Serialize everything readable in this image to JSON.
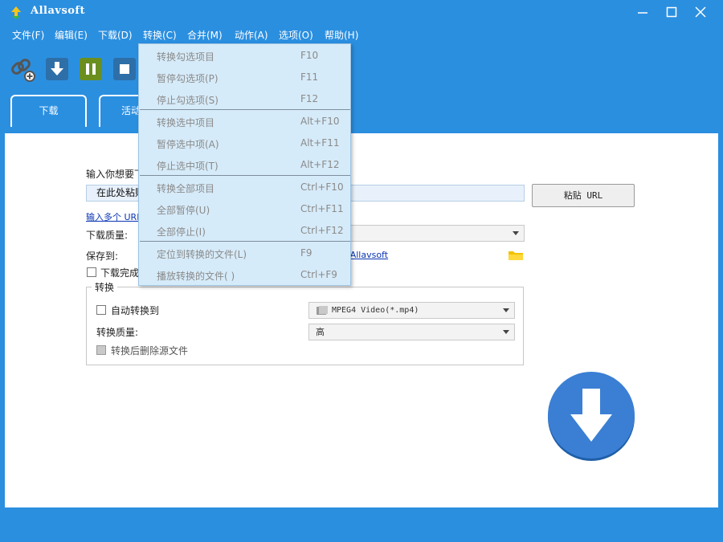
{
  "app": {
    "title": "Allavsoft"
  },
  "menubar": {
    "items": [
      {
        "label": "文件(F)"
      },
      {
        "label": "编辑(E)"
      },
      {
        "label": "下载(D)"
      },
      {
        "label": "转换(C)"
      },
      {
        "label": "合并(M)"
      },
      {
        "label": "动作(A)"
      },
      {
        "label": "选项(O)"
      },
      {
        "label": "帮助(H)"
      }
    ]
  },
  "tabs": {
    "download": "下载",
    "active": "活动"
  },
  "form": {
    "url_prompt": "输入你想要下",
    "url_input_value": "在此处粘贴",
    "paste_button": "粘贴 URL",
    "multi_url_link": "输入多个 URL",
    "quality_label": "下载质量:",
    "save_to_label": "保存到:",
    "save_path": "\\Allavsoft",
    "after_download_label": "下载完成"
  },
  "convert": {
    "group_label": "转换",
    "auto_convert_label": "自动转换到",
    "format_value": "MPEG4 Video(*.mp4)",
    "quality_label": "转换质量:",
    "quality_value": "高",
    "delete_source_label": "转换后删除源文件"
  },
  "convert_menu": {
    "groups": [
      [
        {
          "label": "转换勾选项目",
          "shortcut": "F10"
        },
        {
          "label": "暂停勾选项(P)",
          "shortcut": "F11"
        },
        {
          "label": "停止勾选项(S)",
          "shortcut": "F12"
        }
      ],
      [
        {
          "label": "转换选中项目",
          "shortcut": "Alt+F10"
        },
        {
          "label": "暂停选中项(A)",
          "shortcut": "Alt+F11"
        },
        {
          "label": "停止选中项(T)",
          "shortcut": "Alt+F12"
        }
      ],
      [
        {
          "label": "转换全部项目",
          "shortcut": "Ctrl+F10"
        },
        {
          "label": "全部暂停(U)",
          "shortcut": "Ctrl+F11"
        },
        {
          "label": "全部停止(I)",
          "shortcut": "Ctrl+F12"
        }
      ],
      [
        {
          "label": "定位到转换的文件(L)",
          "shortcut": "F9"
        },
        {
          "label": "播放转换的文件( )",
          "shortcut": "Ctrl+F9"
        }
      ]
    ]
  },
  "colors": {
    "accent": "#2b8fe0",
    "menu_bg": "#d6ebf9",
    "menu_text_disabled": "#8a8a8a",
    "link": "#0a34b3"
  },
  "icons": {
    "toolbar": [
      "add-link-icon",
      "download-icon",
      "pause-icon",
      "stop-icon"
    ],
    "window": [
      "minimize-icon",
      "maximize-icon",
      "close-icon"
    ]
  }
}
